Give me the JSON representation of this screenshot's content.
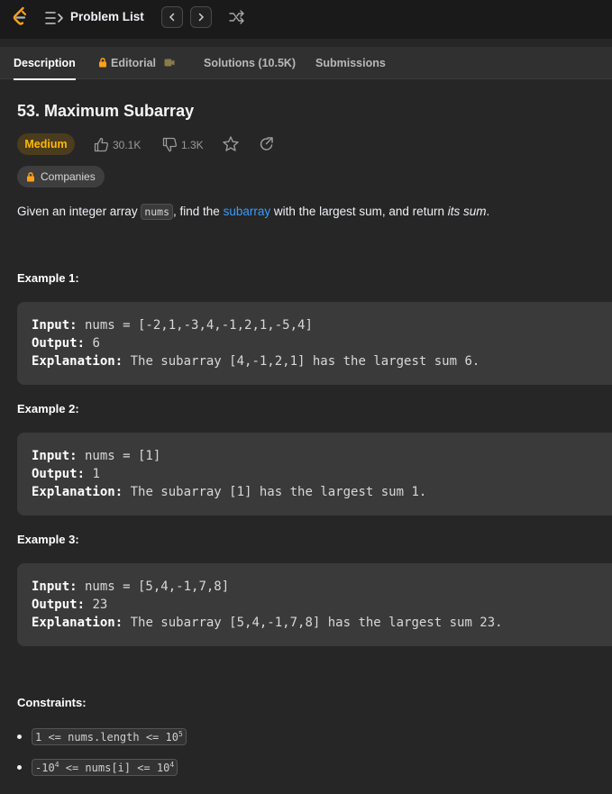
{
  "topbar": {
    "title": "Problem List",
    "icons": [
      "leetcode-logo-icon",
      "list-icon",
      "chevron-left-icon",
      "chevron-right-icon",
      "shuffle-icon"
    ]
  },
  "tabs": [
    {
      "label": "Description",
      "active": true
    },
    {
      "label": "Editorial",
      "locked": true,
      "icon": "video-icon"
    },
    {
      "label": "Solutions (10.5K)"
    },
    {
      "label": "Submissions"
    }
  ],
  "problem": {
    "title": "53. Maximum Subarray",
    "difficulty": "Medium",
    "likes": "30.1K",
    "dislikes": "1.3K",
    "companies_label": "Companies",
    "description": {
      "part1": "Given an integer array ",
      "code": "nums",
      "part2": ", find the ",
      "link": "subarray",
      "part3": " with the largest sum, and return ",
      "italic": "its sum",
      "part4": "."
    }
  },
  "examples": [
    {
      "title": "Example 1:",
      "input_label": "Input:",
      "input": " nums = [-2,1,-3,4,-1,2,1,-5,4]",
      "output_label": "Output:",
      "output": " 6",
      "explanation_label": "Explanation:",
      "explanation": " The subarray [4,-1,2,1] has the largest sum 6."
    },
    {
      "title": "Example 2:",
      "input_label": "Input:",
      "input": " nums = [1]",
      "output_label": "Output:",
      "output": " 1",
      "explanation_label": "Explanation:",
      "explanation": " The subarray [1] has the largest sum 1."
    },
    {
      "title": "Example 3:",
      "input_label": "Input:",
      "input": " nums = [5,4,-1,7,8]",
      "output_label": "Output:",
      "output": " 23",
      "explanation_label": "Explanation:",
      "explanation": " The subarray [5,4,-1,7,8] has the largest sum 23."
    }
  ],
  "constraints": {
    "title": "Constraints:",
    "items": [
      {
        "pre": "1 <= nums.length <= 10",
        "sup": "5",
        "post": ""
      },
      {
        "pre": "-10",
        "sup": "4",
        "post": " <= nums[i] <= 10",
        "sup2": "4"
      }
    ]
  },
  "colors": {
    "accent_link": "#3b9cff",
    "difficulty_medium": "#ffb800",
    "lock": "#ffa116"
  }
}
